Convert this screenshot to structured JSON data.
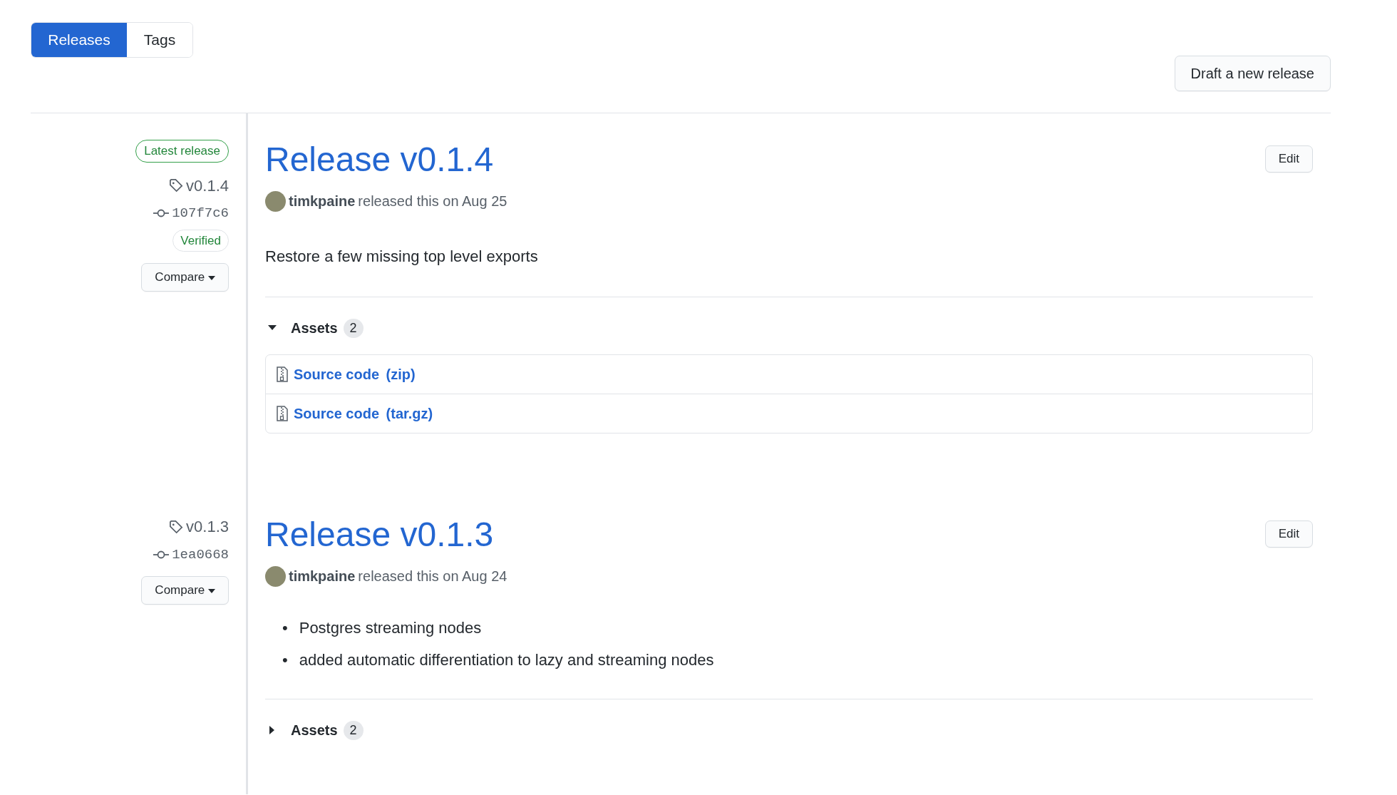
{
  "tabs": [
    {
      "label": "Releases",
      "selected": true
    },
    {
      "label": "Tags",
      "selected": false
    }
  ],
  "draft_button": "Draft a new release",
  "releases": [
    {
      "badge": "Latest release",
      "tag": "v0.1.4",
      "commit": "107f7c6",
      "verified": "Verified",
      "compare": "Compare",
      "title": "Release v0.1.4",
      "author": "timkpaine",
      "meta": "released this on Aug 25",
      "edit": "Edit",
      "notes": [
        {
          "kind": "paragraph",
          "text": "Restore a few missing top level exports"
        }
      ],
      "assets": {
        "label": "Assets",
        "count": "2",
        "expanded": true,
        "items": [
          {
            "name": "Source code",
            "format": "(zip)"
          },
          {
            "name": "Source code",
            "format": "(tar.gz)"
          }
        ]
      }
    },
    {
      "tag": "v0.1.3",
      "commit": "1ea0668",
      "compare": "Compare",
      "title": "Release v0.1.3",
      "author": "timkpaine",
      "meta": "released this on Aug 24",
      "edit": "Edit",
      "notes": [
        {
          "kind": "bullet",
          "marker": "•",
          "text": "Postgres streaming nodes"
        },
        {
          "kind": "bullet",
          "marker": "•",
          "text": "added automatic differentiation to lazy and streaming nodes"
        }
      ],
      "assets": {
        "label": "Assets",
        "count": "2",
        "expanded": false
      }
    }
  ]
}
